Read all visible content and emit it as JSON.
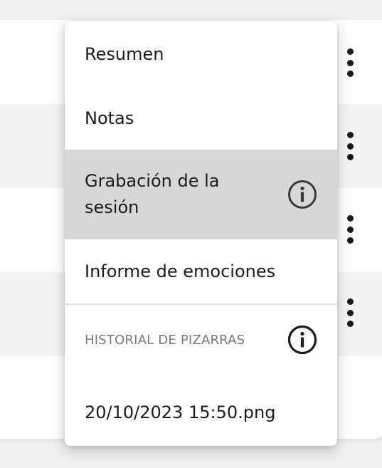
{
  "menu": {
    "items": [
      {
        "label": "Resumen"
      },
      {
        "label": "Notas"
      },
      {
        "label": "Grabación de la sesión",
        "highlighted": true,
        "icon": "info-icon"
      },
      {
        "label": "Informe de emociones"
      }
    ],
    "section": {
      "header": "HISTORIAL DE PIZARRAS",
      "icon": "info-icon",
      "files": [
        {
          "label": "20/10/2023 15:50.png"
        }
      ]
    }
  },
  "background_list": {
    "row_actions_icon": "more-vert-icon"
  },
  "colors": {
    "highlight": "#d7d7d7",
    "text": "#1c1c1c",
    "muted": "#7a7a7a",
    "stripe": "#f3f3f3"
  }
}
